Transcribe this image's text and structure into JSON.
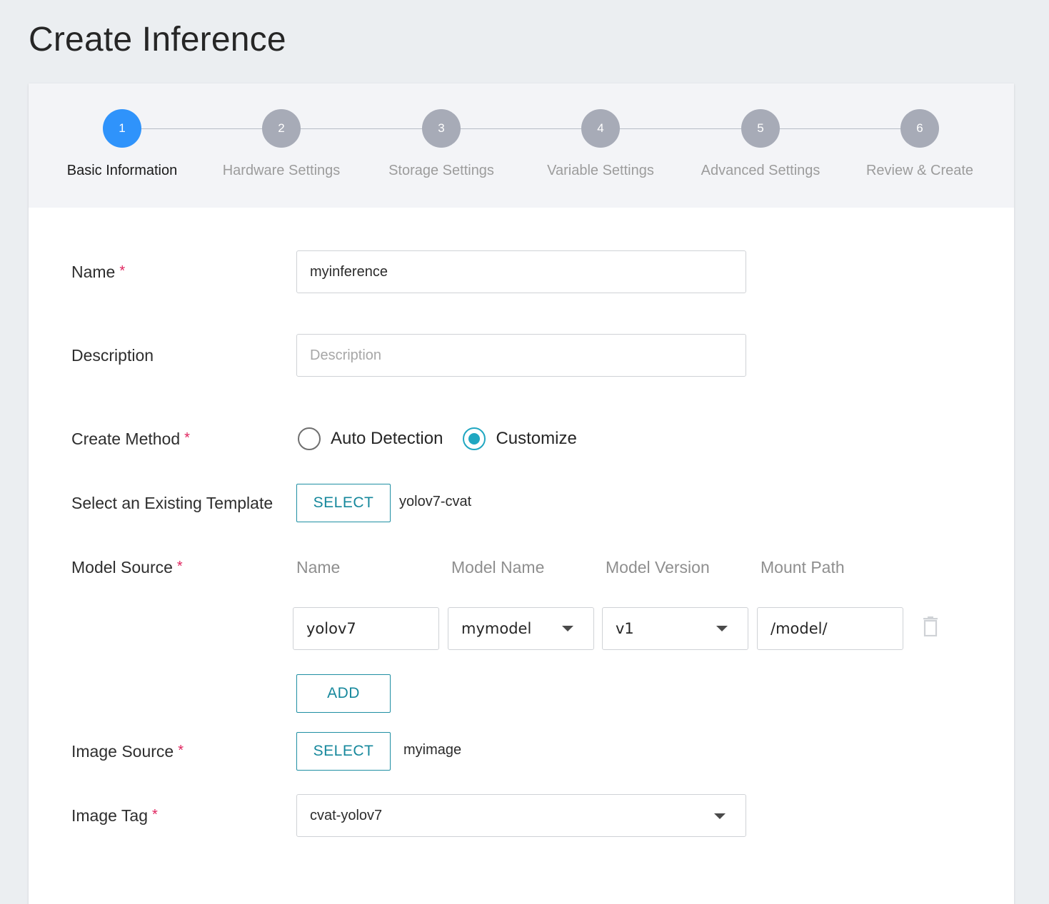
{
  "page": {
    "title": "Create Inference"
  },
  "stepper": {
    "steps": [
      {
        "number": "1",
        "label": "Basic Information"
      },
      {
        "number": "2",
        "label": "Hardware Settings"
      },
      {
        "number": "3",
        "label": "Storage Settings"
      },
      {
        "number": "4",
        "label": "Variable Settings"
      },
      {
        "number": "5",
        "label": "Advanced Settings"
      },
      {
        "number": "6",
        "label": "Review & Create"
      }
    ],
    "active_step": 1
  },
  "form": {
    "name": {
      "label": "Name",
      "required_mark": "*",
      "value": "myinference"
    },
    "description": {
      "label": "Description",
      "placeholder": "Description",
      "value": ""
    },
    "create_method": {
      "label": "Create Method",
      "required_mark": "*",
      "options": [
        "Auto Detection",
        "Customize"
      ],
      "selected": "Customize"
    },
    "template": {
      "label": "Select an Existing Template",
      "button": "SELECT",
      "selected_value": "yolov7-cvat"
    },
    "model_source": {
      "label": "Model Source",
      "required_mark": "*",
      "columns": [
        "Name",
        "Model Name",
        "Model Version",
        "Mount Path"
      ],
      "rows": [
        {
          "name": "yolov7",
          "model_name": "mymodel",
          "model_version": "v1",
          "mount_path": "/model/"
        }
      ],
      "delete_icon": "trash-icon",
      "add_button": "ADD"
    },
    "image_source": {
      "label": "Image Source",
      "required_mark": "*",
      "button": "SELECT",
      "selected_value": "myimage"
    },
    "image_tag": {
      "label": "Image Tag",
      "required_mark": "*",
      "value": "cvat-yolov7"
    }
  },
  "colors": {
    "accent": "#2f93fb",
    "teal": "#1f8fa3",
    "radio_selected": "#20a7c1",
    "required": "#e0245e",
    "inactive_step": "#a7abb7"
  }
}
